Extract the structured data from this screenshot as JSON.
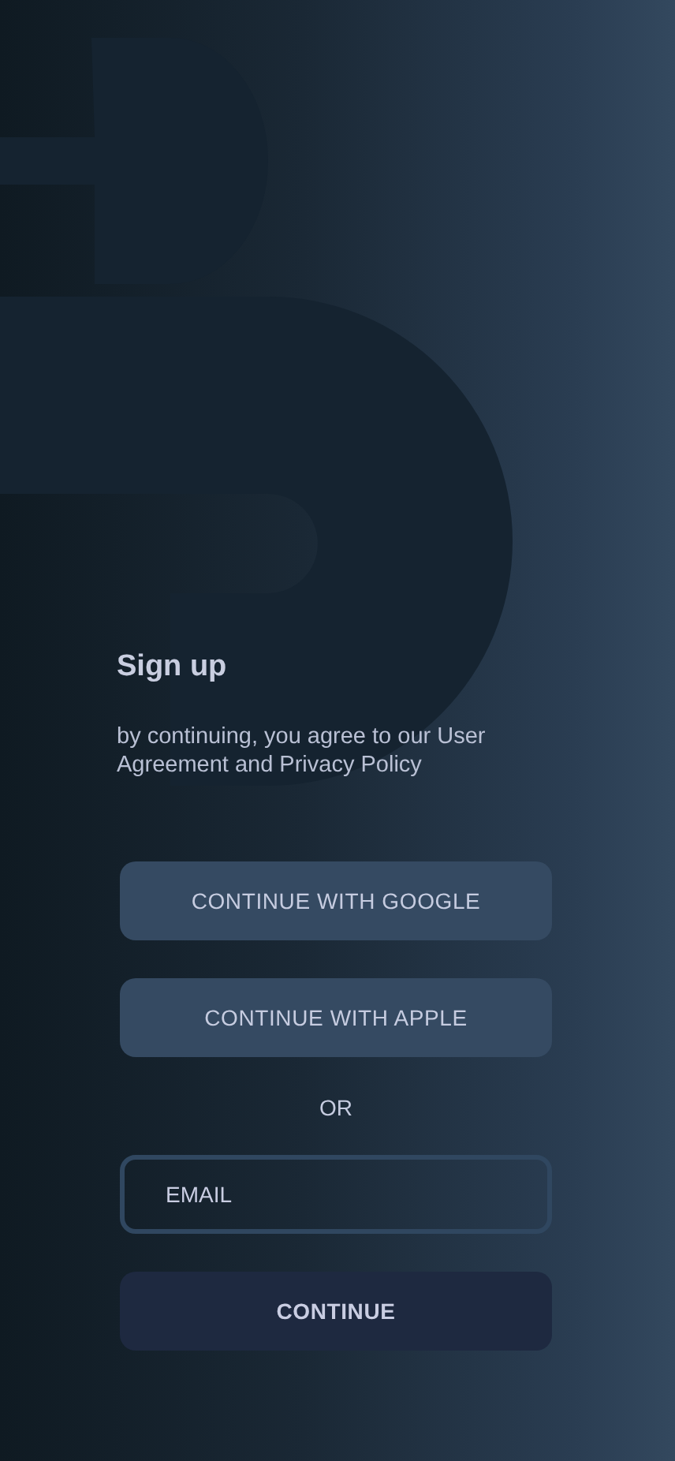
{
  "title": "Sign up",
  "agreement": "by continuing, you agree to our User Agreement and Privacy Policy",
  "social_buttons": [
    "CONTINUE WITH GOOGLE",
    "CONTINUE WITH APPLE"
  ],
  "divider": "OR",
  "email": {
    "placeholder": "EMAIL"
  },
  "submit": "CONTINUE"
}
